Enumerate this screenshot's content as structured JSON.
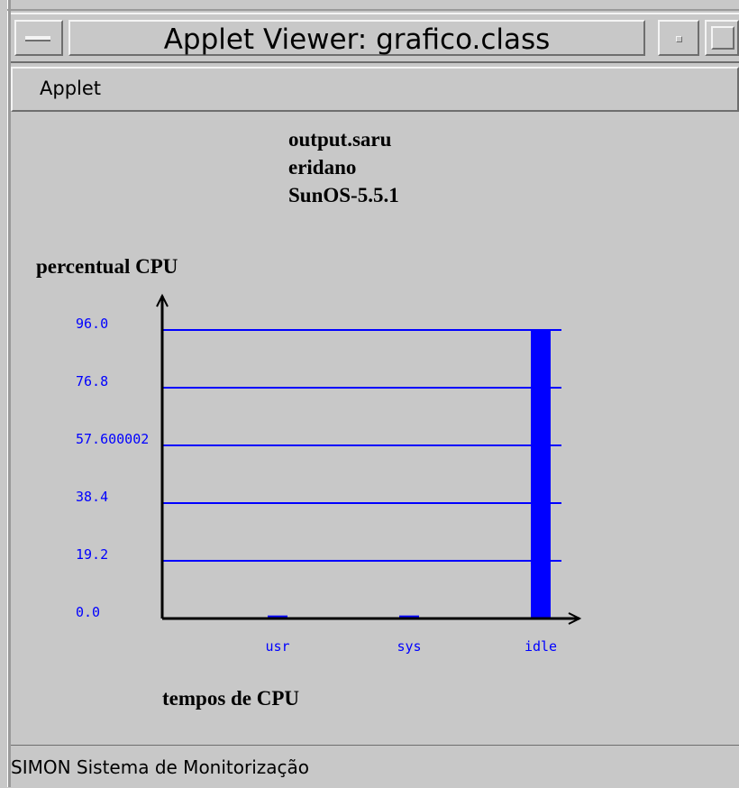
{
  "window": {
    "title": "Applet Viewer: grafico.class"
  },
  "menu": {
    "items": [
      {
        "label": "Applet"
      }
    ]
  },
  "header": {
    "line1": "output.saru",
    "line2": "eridano",
    "line3": "SunOS-5.5.1"
  },
  "status": {
    "text": "SIMON  Sistema de Monitorização"
  },
  "colors": {
    "bar": "#0000ff",
    "gridline": "#0000ff",
    "tick_label": "#0000ff",
    "axis": "#000000",
    "background": "#c8c8c8"
  },
  "chart_data": {
    "type": "bar",
    "ylabel": "percentual CPU",
    "xlabel": "tempos de CPU",
    "categories": [
      "usr",
      "sys",
      "idle"
    ],
    "values": [
      1,
      1,
      96
    ],
    "yticks": [
      "0.0",
      "19.2",
      "38.4",
      "57.600002",
      "76.8",
      "96.0"
    ],
    "ytick_values": [
      0,
      19.2,
      38.4,
      57.600002,
      76.8,
      96
    ],
    "ylim": [
      0,
      96
    ],
    "grid": true
  }
}
